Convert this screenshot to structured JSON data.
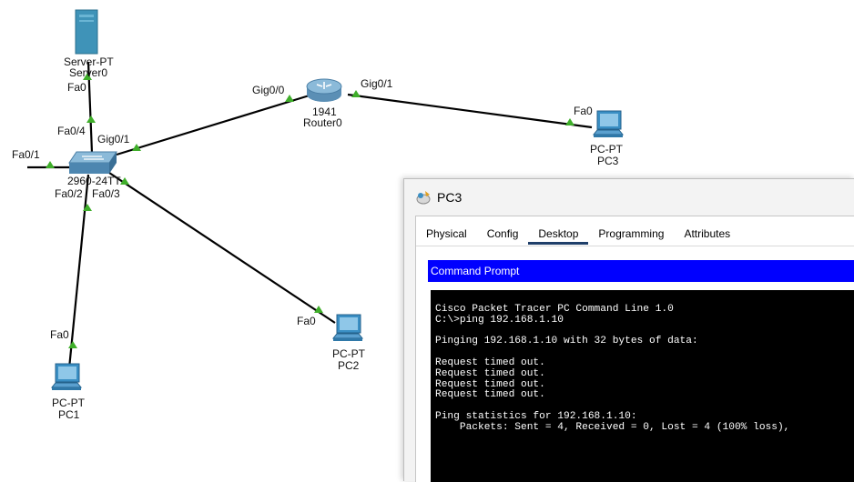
{
  "devices": {
    "server": {
      "model": "Server-PT",
      "name": "Server0",
      "port": "Fa0"
    },
    "router": {
      "model": "1941",
      "name": "Router0",
      "port_left": "Gig0/0",
      "port_right": "Gig0/1"
    },
    "switch": {
      "model": "2960-24TT",
      "ports": {
        "fa04": "Fa0/4",
        "gig01": "Gig0/1",
        "fa01": "Fa0/1",
        "fa02": "Fa0/2",
        "fa03": "Fa0/3"
      }
    },
    "pc1": {
      "model": "PC-PT",
      "name": "PC1",
      "port": "Fa0"
    },
    "pc2": {
      "model": "PC-PT",
      "name": "PC2",
      "port": "Fa0"
    },
    "pc3": {
      "model": "PC-PT",
      "name": "PC3",
      "port": "Fa0"
    }
  },
  "window": {
    "title": "PC3",
    "tabs": [
      {
        "label": "Physical",
        "active": false
      },
      {
        "label": "Config",
        "active": false
      },
      {
        "label": "Desktop",
        "active": true
      },
      {
        "label": "Programming",
        "active": false
      },
      {
        "label": "Attributes",
        "active": false
      }
    ],
    "app_title": "Command Prompt",
    "terminal_text": "Cisco Packet Tracer PC Command Line 1.0\nC:\\>ping 192.168.1.10\n\nPinging 192.168.1.10 with 32 bytes of data:\n\nRequest timed out.\nRequest timed out.\nRequest timed out.\nRequest timed out.\n\nPing statistics for 192.168.1.10:\n    Packets: Sent = 4, Received = 0, Lost = 4 (100% loss),"
  },
  "colors": {
    "link": "#000000",
    "port_indicator": "#3fae2a",
    "device_blue": "#3a8fc4",
    "cmd_bar": "#0000ff"
  }
}
